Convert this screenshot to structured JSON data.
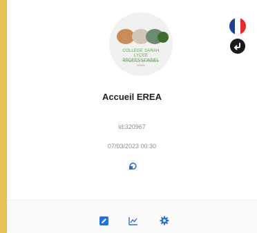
{
  "card": {
    "title": "Accueil EREA",
    "id_label": "id:320967",
    "datetime": "07/03/2023 00:30"
  },
  "logo": {
    "caption_line1": "COLLEGE SARAH",
    "caption_line2": "LYCEE PROFESSIONNEL",
    "caption_line3": "REGION ILE DE FRANCE",
    "caption_line4": "WWW"
  },
  "icons": {
    "language": "france-flag-icon",
    "back": "return-arrow-icon",
    "status": "sync-icon",
    "edit": "edit-icon",
    "stats": "chart-icon",
    "settings": "gear-icon"
  },
  "colors": {
    "frame": "#e9c35a",
    "accent": "#2a6fd6",
    "text": "#222222",
    "muted": "#8c8c8c"
  }
}
